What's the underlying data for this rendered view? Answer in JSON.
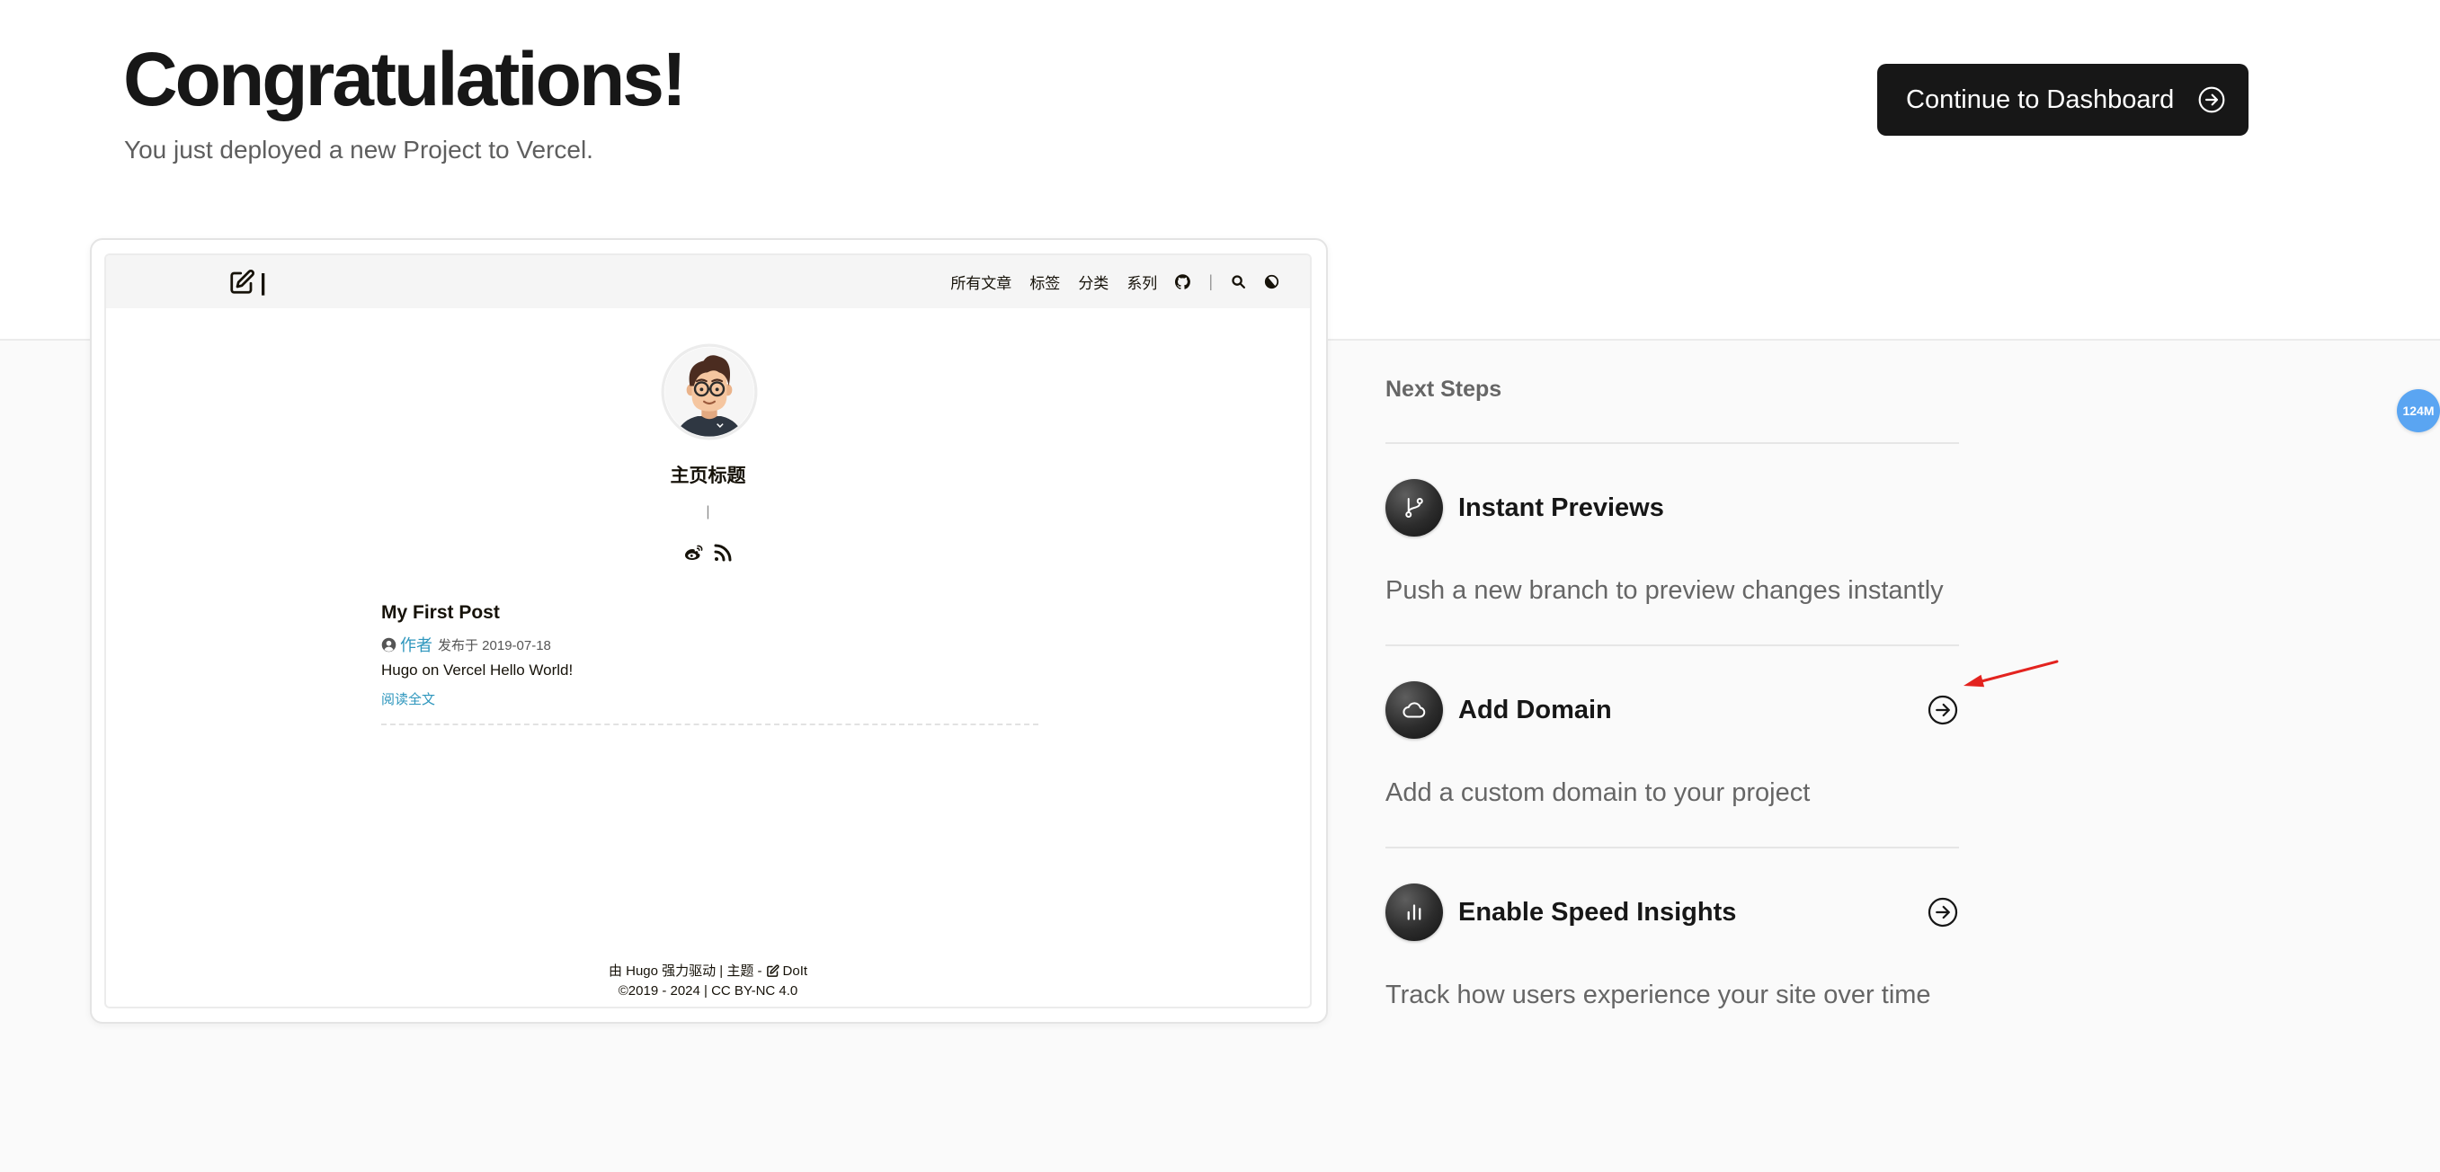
{
  "header": {
    "title": "Congratulations!",
    "subtitle": "You just deployed a new Project to Vercel.",
    "continue_button": {
      "label": "Continue to Dashboard",
      "icon": "arrow-circle-right-icon"
    }
  },
  "preview": {
    "nav": {
      "logo_icon": "edit-icon",
      "logo_cursor": "|",
      "items": [
        "所有文章",
        "标签",
        "分类",
        "系列"
      ],
      "separator": "|",
      "icons": [
        "github-icon",
        "search-icon",
        "theme-toggle-icon"
      ]
    },
    "profile": {
      "avatar_icon": "avatar",
      "title": "主页标题",
      "subtitle": "|",
      "social_icons": [
        "weibo-icon",
        "rss-icon"
      ]
    },
    "posts": [
      {
        "title": "My First Post",
        "author_icon": "user-circle-icon",
        "author": "作者",
        "published": "发布于 2019-07-18",
        "summary": "Hugo on Vercel Hello World!",
        "read_more": "阅读全文"
      }
    ],
    "footer": {
      "powered_by": "由 Hugo 强力驱动 | 主题 -",
      "theme_icon": "edit-icon",
      "theme_name": "DoIt",
      "copyright": "©2019 - 2024 | CC BY-NC 4.0"
    }
  },
  "next_steps": {
    "heading": "Next Steps",
    "items": [
      {
        "title": "Instant Previews",
        "description": "Push a new branch to preview changes instantly",
        "icon": "git-branch-icon"
      },
      {
        "title": "Add Domain",
        "description": "Add a custom domain to your project",
        "icon": "cloud-icon",
        "action_icon": "arrow-circle-right-icon"
      },
      {
        "title": "Enable Speed Insights",
        "description": "Track how users experience your site over time",
        "icon": "bar-chart-icon",
        "action_icon": "arrow-circle-right-icon"
      }
    ]
  },
  "floating_badge": {
    "label": "124M"
  },
  "colors": {
    "text_primary": "#171717",
    "text_secondary": "#666666",
    "button_bg": "#171717",
    "page_section_bg": "#fafafa",
    "site_link": "#2d96bd",
    "annotation_arrow": "#e3231f",
    "badge_bg": "#5aa5f2"
  }
}
